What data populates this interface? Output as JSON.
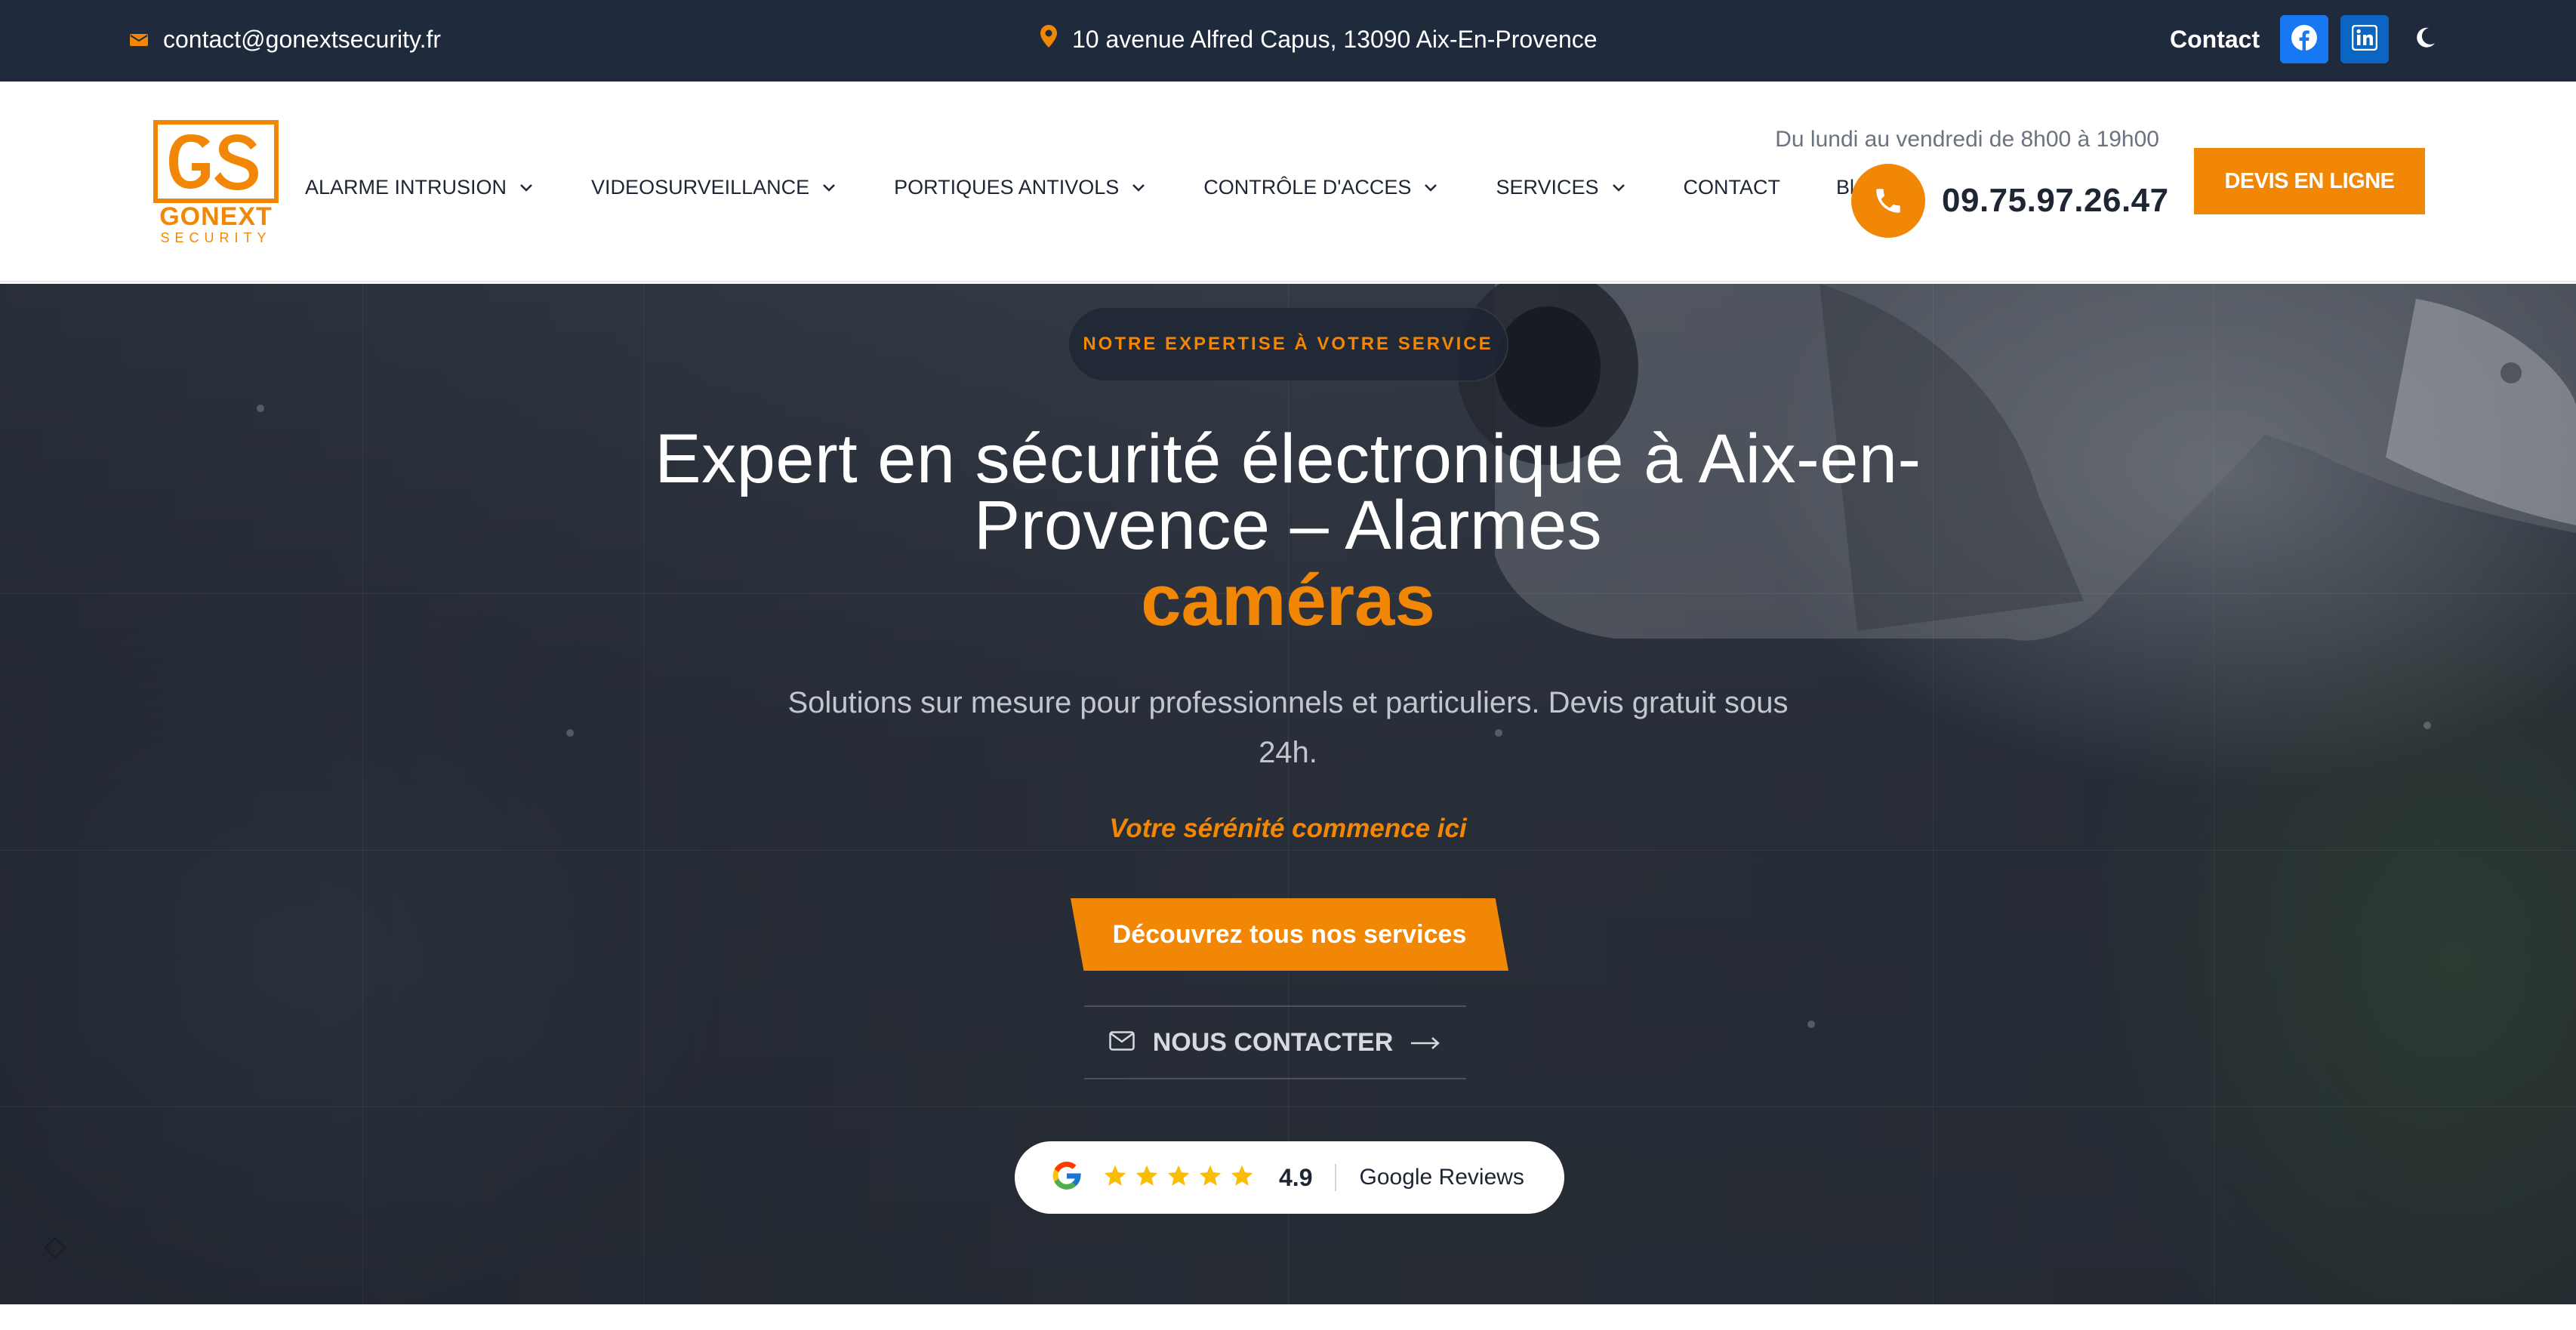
{
  "topbar": {
    "email": "contact@gonextsecurity.fr",
    "address": "10 avenue Alfred Capus, 13090 Aix-En-Provence",
    "contact_label": "Contact"
  },
  "header": {
    "logo_brand": "GONEXT",
    "logo_sub": "SECURITY",
    "nav": [
      {
        "label": "ALARME INTRUSION"
      },
      {
        "label": "VIDEOSURVEILLANCE"
      },
      {
        "label": "PORTIQUES ANTIVOLS"
      },
      {
        "label": "CONTRÔLE D'ACCES"
      },
      {
        "label": "SERVICES"
      },
      {
        "label": "CONTACT"
      },
      {
        "label": "Blog"
      }
    ],
    "hours": "Du lundi au vendredi de 8h00 à 19h00",
    "phone": "09.75.97.26.47",
    "cta": "DEVIS EN LIGNE"
  },
  "hero": {
    "badge": "NOTRE EXPERTISE À VOTRE SERVICE",
    "title_line1": "Expert en sécurité électronique à Aix-en-",
    "title_line2": "Provence – Alarmes",
    "title_accent": "caméras",
    "subtitle_line1": "Solutions sur mesure pour professionnels et particuliers. Devis gratuit sous",
    "subtitle_line2": "24h.",
    "tagline": "Votre sérénité commence ici",
    "cta_primary": "Découvrez tous nos services",
    "cta_secondary": "NOUS CONTACTER",
    "reviews": {
      "rating": "4.9",
      "stars": 5,
      "label": "Google Reviews"
    }
  },
  "colors": {
    "accent": "#f28705",
    "topbar_bg": "#1f2a3c",
    "facebook": "#1877f2",
    "linkedin": "#0a66c2"
  }
}
